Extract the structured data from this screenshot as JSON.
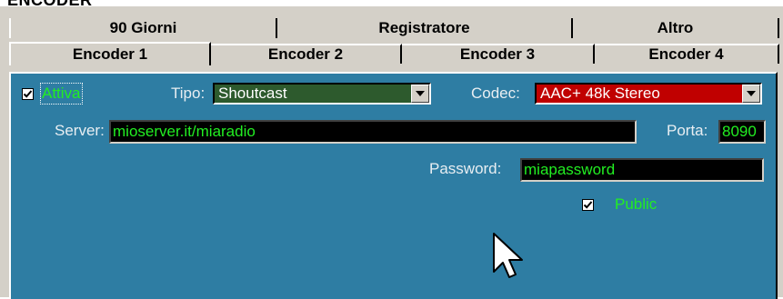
{
  "title": "ENCODER",
  "tabs_row1": [
    {
      "label": "90 Giorni"
    },
    {
      "label": "Registratore"
    },
    {
      "label": "Altro"
    }
  ],
  "tabs_row2": [
    {
      "label": "Encoder 1",
      "active": true
    },
    {
      "label": "Encoder 2"
    },
    {
      "label": "Encoder 3"
    },
    {
      "label": "Encoder 4"
    }
  ],
  "encoder": {
    "attiva": {
      "label": "Attiva",
      "checked": true
    },
    "tipo": {
      "label": "Tipo:",
      "value": "Shoutcast",
      "color": "#2d5a2d"
    },
    "codec": {
      "label": "Codec:",
      "value": "AAC+ 48k Stereo",
      "color": "#c00000"
    },
    "server": {
      "label": "Server:",
      "value": "mioserver.it/miaradio"
    },
    "porta": {
      "label": "Porta:",
      "value": "8090"
    },
    "password": {
      "label": "Password:",
      "value": "miapassword"
    },
    "public": {
      "label": "Public",
      "checked": true
    }
  },
  "colors": {
    "panel": "#2e7da3",
    "field_text": "#22ee22",
    "tab_bg": "#d4d0c8"
  },
  "icons": {
    "dropdown": "chevron-down-icon",
    "check": "check-icon",
    "cursor": "mouse-pointer-icon"
  }
}
